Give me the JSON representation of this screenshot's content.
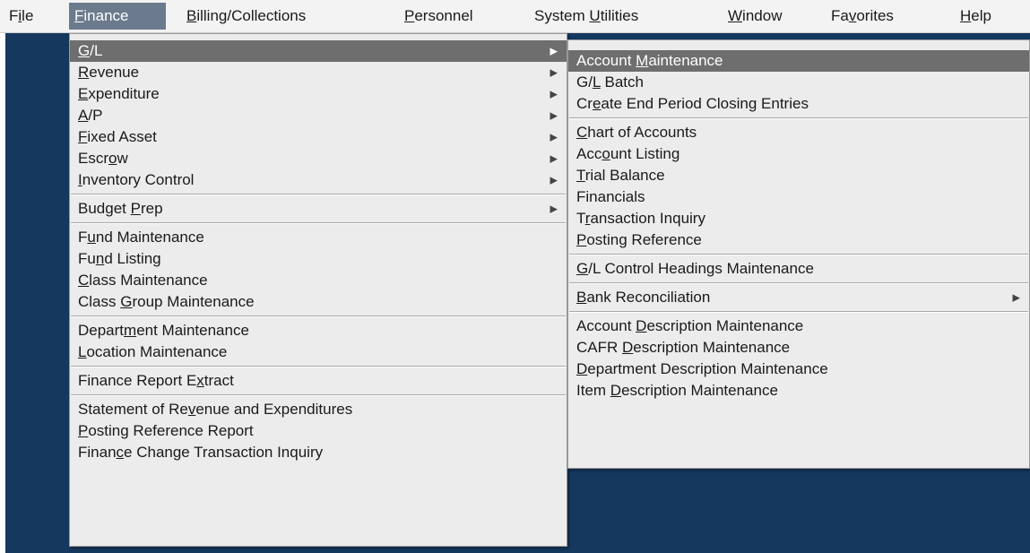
{
  "menubar": {
    "items": [
      {
        "label": "File",
        "mn": 1
      },
      {
        "label": "Finance",
        "mn": 0
      },
      {
        "label": "Billing/Collections",
        "mn": 0
      },
      {
        "label": "Personnel",
        "mn": 0
      },
      {
        "label": "System Utilities",
        "mn": 7
      },
      {
        "label": "Window",
        "mn": 0
      },
      {
        "label": "Favorites",
        "mn": 2
      },
      {
        "label": "Help",
        "mn": 0
      }
    ],
    "active_index": 1
  },
  "finance_menu": {
    "items": [
      {
        "label": "G/L",
        "mn": 0,
        "arrow": true,
        "highlight": true
      },
      {
        "label": "Revenue",
        "mn": 0,
        "arrow": true
      },
      {
        "label": "Expenditure",
        "mn": 0,
        "arrow": true
      },
      {
        "label": "A/P",
        "mn": 0,
        "arrow": true
      },
      {
        "label": "Fixed Asset",
        "mn": 0,
        "arrow": true
      },
      {
        "label": "Escrow",
        "mn": 4,
        "arrow": true
      },
      {
        "label": "Inventory Control",
        "mn": 0,
        "arrow": true
      },
      {
        "sep": true
      },
      {
        "label": "Budget Prep",
        "mn": 7,
        "arrow": true
      },
      {
        "sep": true
      },
      {
        "label": "Fund Maintenance",
        "mn": 1
      },
      {
        "label": "Fund Listing",
        "mn": 2
      },
      {
        "label": "Class Maintenance",
        "mn": 0
      },
      {
        "label": "Class Group Maintenance",
        "mn": 6
      },
      {
        "sep": true
      },
      {
        "label": "Department Maintenance",
        "mn": 6
      },
      {
        "label": "Location Maintenance",
        "mn": 0
      },
      {
        "sep": true
      },
      {
        "label": "Finance Report Extract",
        "mn": 16
      },
      {
        "sep": true
      },
      {
        "label": "Statement of Revenue and Expenditures",
        "mn": 15
      },
      {
        "label": "Posting Reference Report",
        "mn": 0
      },
      {
        "label": "Finance Change Transaction Inquiry",
        "mn": 5
      }
    ]
  },
  "gl_menu": {
    "items": [
      {
        "label": "Account Maintenance",
        "mn": 8,
        "highlight": true
      },
      {
        "label": "G/L Batch",
        "mn": 2
      },
      {
        "label": "Create End Period Closing Entries",
        "mn": 2
      },
      {
        "sep": true
      },
      {
        "label": "Chart of Accounts",
        "mn": 0
      },
      {
        "label": "Account Listing",
        "mn": 3
      },
      {
        "label": "Trial Balance",
        "mn": 0
      },
      {
        "label": "Financials",
        "mn": -1
      },
      {
        "label": "Transaction Inquiry",
        "mn": 1
      },
      {
        "label": "Posting Reference",
        "mn": 0
      },
      {
        "sep": true
      },
      {
        "label": "G/L Control Headings Maintenance",
        "mn": 0
      },
      {
        "sep": true
      },
      {
        "label": "Bank Reconciliation",
        "mn": 0,
        "arrow": true
      },
      {
        "sep": true
      },
      {
        "label": "Account Description Maintenance",
        "mn": 8
      },
      {
        "label": "CAFR Description Maintenance",
        "mn": 5
      },
      {
        "label": "Department Description Maintenance",
        "mn": 0
      },
      {
        "label": "Item Description Maintenance",
        "mn": 5
      }
    ]
  },
  "colors": {
    "desktop": "#15385f",
    "menu_bg": "#ececec",
    "highlight": "#6e6e6e",
    "menubar_active": "#6b7a8c"
  }
}
